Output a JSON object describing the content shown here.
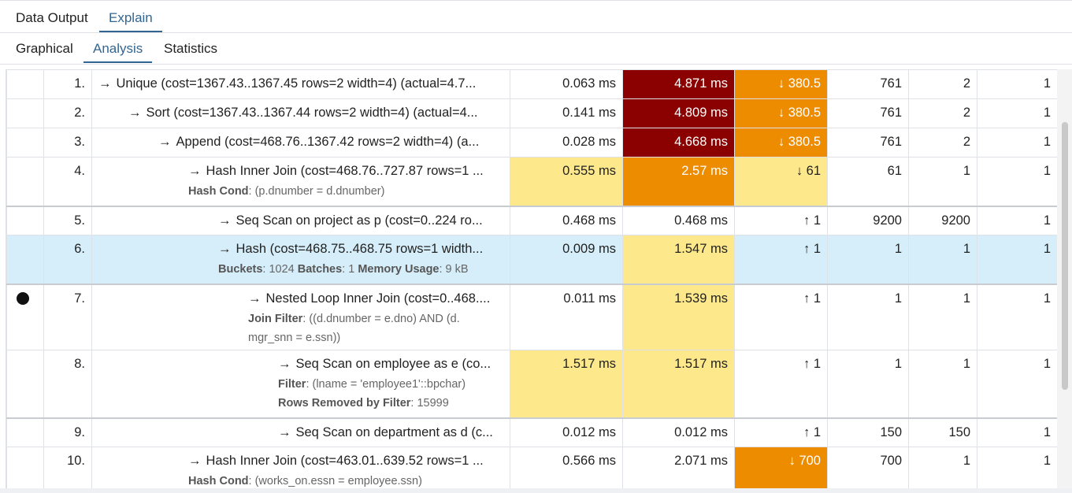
{
  "tabs_top": [
    {
      "label": "Data Output",
      "active": false
    },
    {
      "label": "Explain",
      "active": true
    }
  ],
  "tabs_sub": [
    {
      "label": "Graphical",
      "active": false
    },
    {
      "label": "Analysis",
      "active": true
    },
    {
      "label": "Statistics",
      "active": false
    }
  ],
  "colors": {
    "accent": "#326690",
    "dark_red": "#8b0000",
    "orange": "#ee8c00",
    "yellow": "#fde98c",
    "selected_row": "#d6eefa"
  },
  "rows": [
    {
      "n": "1.",
      "node": "Unique (cost=1367.43..1367.45 rows=2 width=4) (actual=4.7...",
      "details": [],
      "excl": "0.063 ms",
      "incl": "4.871 ms",
      "rowsx": "↓ 380.5",
      "actual": "761",
      "plan": "2",
      "loops": "1"
    },
    {
      "n": "2.",
      "node": "Sort (cost=1367.43..1367.44 rows=2 width=4) (actual=4...",
      "details": [],
      "excl": "0.141 ms",
      "incl": "4.809 ms",
      "rowsx": "↓ 380.5",
      "actual": "761",
      "plan": "2",
      "loops": "1"
    },
    {
      "n": "3.",
      "node": "Append (cost=468.76..1367.42 rows=2 width=4) (a...",
      "details": [],
      "excl": "0.028 ms",
      "incl": "4.668 ms",
      "rowsx": "↓ 380.5",
      "actual": "761",
      "plan": "2",
      "loops": "1"
    },
    {
      "n": "4.",
      "node": "Hash Inner Join (cost=468.76..727.87 rows=1 ...",
      "details": [
        {
          "k": "Hash Cond",
          "v": ": (p.dnumber = d.dnumber)"
        }
      ],
      "excl": "0.555 ms",
      "incl": "2.57 ms",
      "rowsx": "↓ 61",
      "actual": "61",
      "plan": "1",
      "loops": "1"
    },
    {
      "n": "5.",
      "node": "Seq Scan on project as p (cost=0..224 ro...",
      "details": [],
      "excl": "0.468 ms",
      "incl": "0.468 ms",
      "rowsx": "↑ 1",
      "actual": "9200",
      "plan": "9200",
      "loops": "1"
    },
    {
      "n": "6.",
      "node": "Hash (cost=468.75..468.75 rows=1 width...",
      "details": [
        {
          "k": "Buckets",
          "v": ": 1024 "
        },
        {
          "k": "Batches",
          "v": ": 1 "
        },
        {
          "k": "Memory Usage",
          "v": ": 9 kB"
        }
      ],
      "excl": "0.009 ms",
      "incl": "1.547 ms",
      "rowsx": "↑ 1",
      "actual": "1",
      "plan": "1",
      "loops": "1"
    },
    {
      "n": "7.",
      "node": "Nested Loop Inner Join (cost=0..468....",
      "details": [
        {
          "k": "Join Filter",
          "v": ": ((d.dnumber = e.dno) AND (d. mgr_snn = e.ssn))"
        }
      ],
      "excl": "0.011 ms",
      "incl": "1.539 ms",
      "rowsx": "↑ 1",
      "actual": "1",
      "plan": "1",
      "loops": "1"
    },
    {
      "n": "8.",
      "node": "Seq Scan on employee as e (co...",
      "details": [
        {
          "k": "Filter",
          "v": ": (lname = 'employee1'::bpchar)"
        },
        {
          "k": "Rows Removed by Filter",
          "v": ": 15999"
        }
      ],
      "excl": "1.517 ms",
      "incl": "1.517 ms",
      "rowsx": "↑ 1",
      "actual": "1",
      "plan": "1",
      "loops": "1"
    },
    {
      "n": "9.",
      "node": "Seq Scan on department as d (c...",
      "details": [],
      "excl": "0.012 ms",
      "incl": "0.012 ms",
      "rowsx": "↑ 1",
      "actual": "150",
      "plan": "150",
      "loops": "1"
    },
    {
      "n": "10.",
      "node": "Hash Inner Join (cost=463.01..639.52 rows=1 ...",
      "details": [
        {
          "k": "Hash Cond",
          "v": ": (works_on.essn = employee.ssn)"
        }
      ],
      "excl": "0.566 ms",
      "incl": "2.071 ms",
      "rowsx": "↓ 700",
      "actual": "700",
      "plan": "1",
      "loops": "1"
    }
  ]
}
